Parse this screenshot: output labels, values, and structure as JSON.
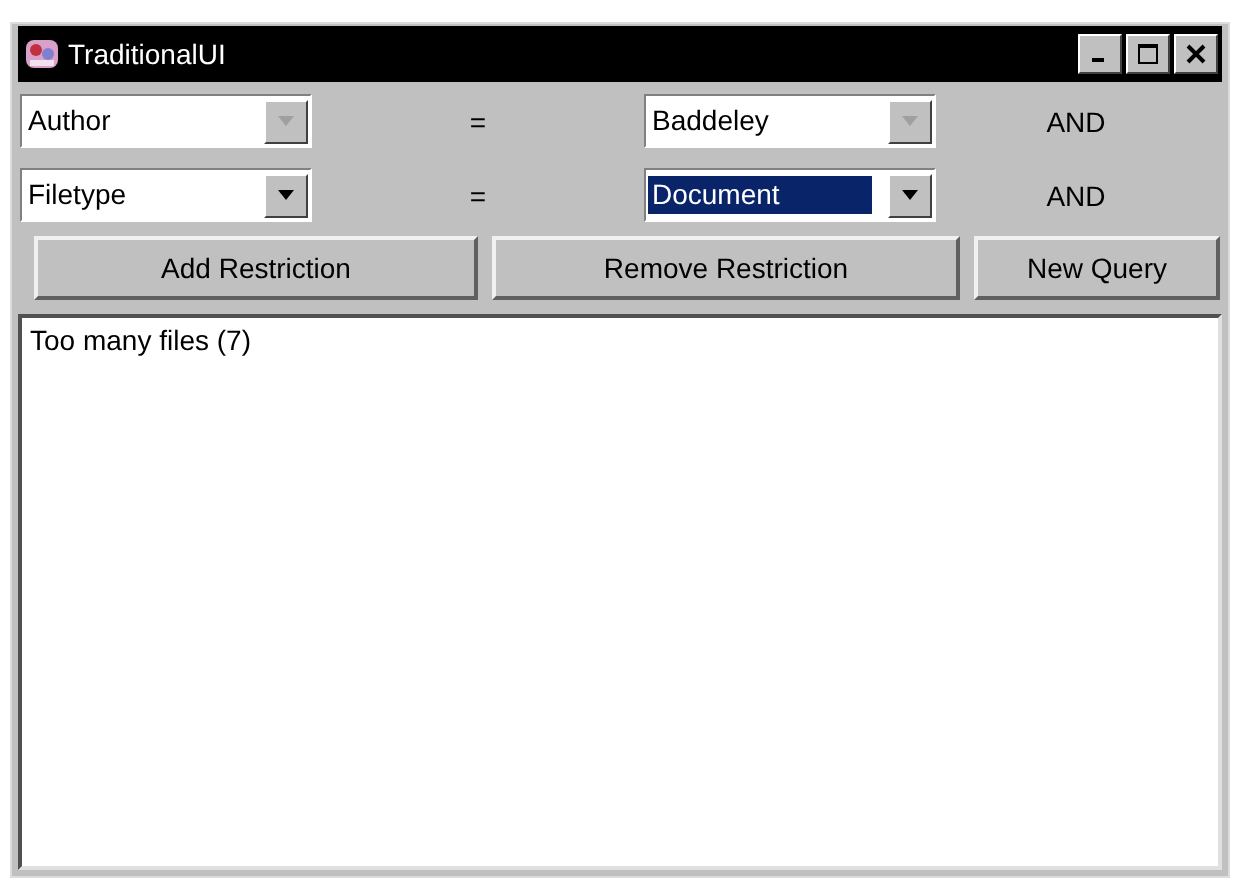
{
  "window": {
    "title": "TraditionalUI"
  },
  "restrictions": [
    {
      "field": {
        "value": "Author",
        "disabled": true,
        "highlighted": false
      },
      "operator": "=",
      "value": {
        "value": "Baddeley",
        "disabled": true,
        "highlighted": false
      },
      "conjunction": "AND"
    },
    {
      "field": {
        "value": "Filetype",
        "disabled": false,
        "highlighted": false
      },
      "operator": "=",
      "value": {
        "value": "Document",
        "disabled": false,
        "highlighted": true
      },
      "conjunction": "AND"
    }
  ],
  "buttons": [
    "Add Restriction",
    "Remove Restriction",
    "New Query"
  ],
  "results": {
    "text": "Too many files (7)"
  }
}
